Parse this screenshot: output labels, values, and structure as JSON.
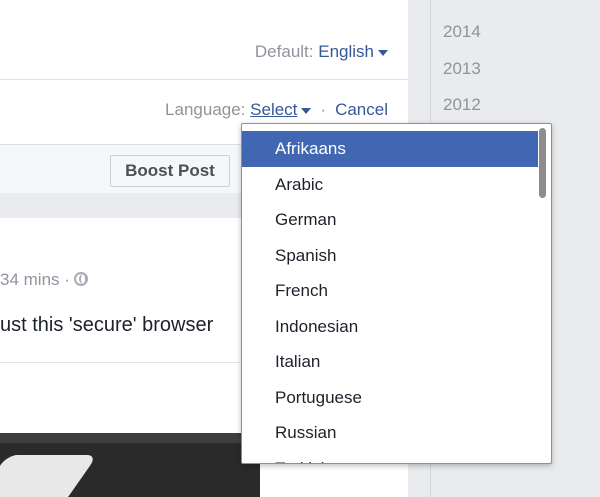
{
  "post": {
    "default_label": "Default:",
    "default_language": "English",
    "language_label": "Language:",
    "select_label": "Select",
    "separator": "·",
    "cancel_label": "Cancel",
    "boost_label": "Boost Post",
    "timestamp": "34 mins ·",
    "text": "ust this 'secure' browser"
  },
  "years": [
    "2014",
    "2013",
    "2012"
  ],
  "language_dropdown": {
    "selected": "Afrikaans",
    "options": [
      "Afrikaans",
      "Arabic",
      "German",
      "Spanish",
      "French",
      "Indonesian",
      "Italian",
      "Portuguese",
      "Russian",
      "Turkish"
    ]
  },
  "colors": {
    "link": "#365899",
    "selected_bg": "#4267b2",
    "muted_text": "#90949c",
    "page_bg": "#e9ebee"
  }
}
